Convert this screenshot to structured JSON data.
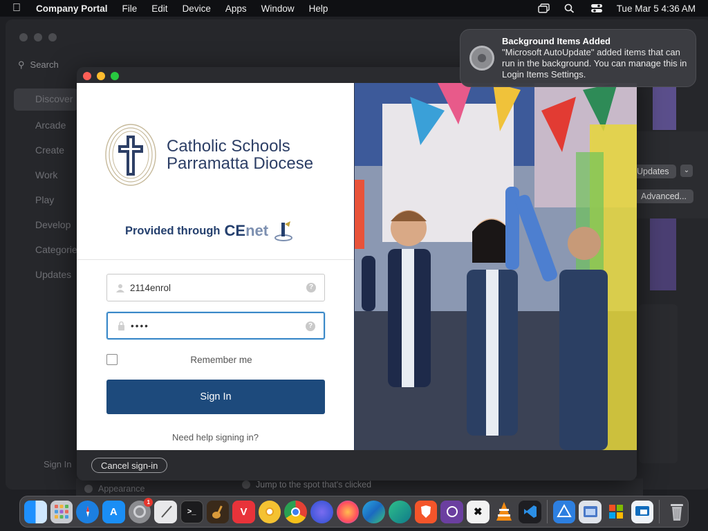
{
  "menubar": {
    "app_name": "Company Portal",
    "items": [
      "File",
      "Edit",
      "Device",
      "Apps",
      "Window",
      "Help"
    ],
    "datetime": "Tue Mar 5  4:36 AM"
  },
  "background_app": {
    "search_placeholder": "Search",
    "sidebar": [
      "Discover",
      "Arcade",
      "Create",
      "Work",
      "Play",
      "Develop",
      "Categories",
      "Updates"
    ],
    "sign_in": "Sign In",
    "updates_button": "Updates",
    "advanced_button": "Advanced...",
    "appearance": "Appearance",
    "jump_option": "Jump to the spot that's clicked",
    "control_center": "Control Center"
  },
  "notification": {
    "title": "Background Items Added",
    "body": "\"Microsoft AutoUpdate\" added items that can run in the background. You can manage this in Login Items Settings.",
    "icon": "gear-icon"
  },
  "login": {
    "org_line1": "Catholic Schools",
    "org_line2": "Parramatta Diocese",
    "provided_through": "Provided through",
    "provider_ce": "CE",
    "provider_net": "net",
    "username_value": "2114enrol",
    "password_value": "••••",
    "remember_label": "Remember me",
    "signin_label": "Sign In",
    "help_link": "Need help signing in?"
  },
  "footer": {
    "cancel_label": "Cancel sign-in"
  },
  "dock": {
    "apps": [
      "Finder",
      "Launchpad",
      "Safari",
      "App Store",
      "System Settings",
      "Script Editor",
      "Terminal",
      "GarageBand",
      "Vivaldi",
      "Chrome Canary",
      "Chrome",
      "Firefox Dev",
      "Firefox",
      "Edge",
      "Edge Canary",
      "Brave",
      "Tor Browser",
      "CapCut",
      "VLC",
      "VS Code",
      "Xcode Tools",
      "Preview",
      "Installer",
      "Remote Desktop",
      "Trash"
    ],
    "settings_badge": "1"
  },
  "colors": {
    "brand_navy": "#1d4a7c",
    "logo_text": "#2d3f66",
    "focus_ring": "#3a88c8"
  }
}
